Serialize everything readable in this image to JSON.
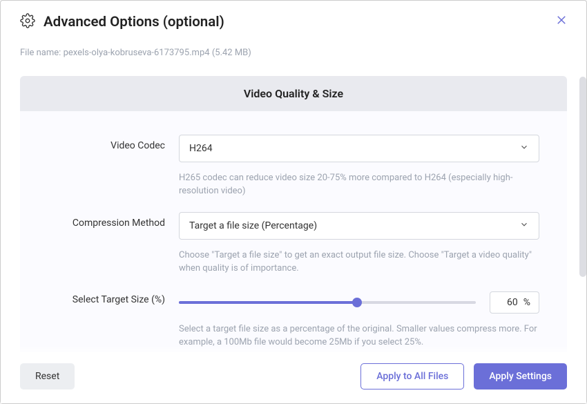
{
  "header": {
    "title": "Advanced Options (optional)"
  },
  "file": {
    "label": "File name:",
    "name": "pexels-olya-kobruseva-6173795.mp4",
    "size": "(5.42 MB)"
  },
  "section": {
    "title": "Video Quality & Size"
  },
  "codec": {
    "label": "Video Codec",
    "value": "H264",
    "help": "H265 codec can reduce video size 20-75% more compared to H264 (especially high-resolution video)"
  },
  "compression": {
    "label": "Compression Method",
    "value": "Target a file size (Percentage)",
    "help": "Choose \"Target a file size\" to get an exact output file size. Choose \"Target a video quality\" when quality is of importance."
  },
  "targetSize": {
    "label": "Select Target Size (%)",
    "value": "60",
    "unit": "%",
    "help": "Select a target file size as a percentage of the original. Smaller values compress more. For example, a 100Mb file would become 25Mb if you select 25%."
  },
  "footer": {
    "reset": "Reset",
    "applyAll": "Apply to All Files",
    "apply": "Apply Settings"
  }
}
